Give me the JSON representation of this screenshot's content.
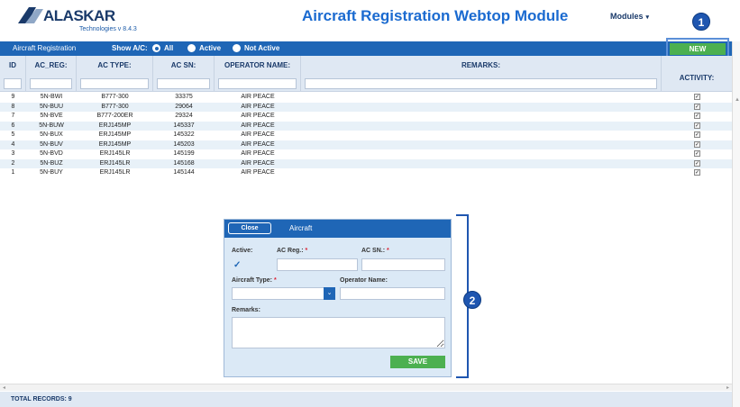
{
  "header": {
    "logo_text": "ALASKAR",
    "logo_sub": "Technologies v 8.4.3",
    "title": "Aircraft Registration Webtop Module",
    "modules_label": "Modules",
    "callout_1": "1",
    "callout_2": "2"
  },
  "toolbar": {
    "label": "Aircraft Registration",
    "show_label": "Show A/C:",
    "radio_all": "All",
    "radio_active": "Active",
    "radio_not_active": "Not Active",
    "selected": "All",
    "new_button": "NEW"
  },
  "grid": {
    "columns": [
      "ID",
      "AC_REG:",
      "AC TYPE:",
      "AC SN:",
      "OPERATOR NAME:",
      "REMARKS:",
      "ACTIVITY:"
    ],
    "rows": [
      {
        "id": "9",
        "reg": "5N-BWI",
        "type": "B777-300",
        "sn": "33375",
        "operator": "AIR PEACE",
        "remarks": "",
        "active": true
      },
      {
        "id": "8",
        "reg": "5N-BUU",
        "type": "B777-300",
        "sn": "29064",
        "operator": "AIR PEACE",
        "remarks": "",
        "active": true
      },
      {
        "id": "7",
        "reg": "5N-BVE",
        "type": "B777-200ER",
        "sn": "29324",
        "operator": "AIR PEACE",
        "remarks": "",
        "active": true
      },
      {
        "id": "6",
        "reg": "5N-BUW",
        "type": "ERJ145MP",
        "sn": "145337",
        "operator": "AIR PEACE",
        "remarks": "",
        "active": true
      },
      {
        "id": "5",
        "reg": "5N-BUX",
        "type": "ERJ145MP",
        "sn": "145322",
        "operator": "AIR PEACE",
        "remarks": "",
        "active": true
      },
      {
        "id": "4",
        "reg": "5N-BUV",
        "type": "ERJ145MP",
        "sn": "145203",
        "operator": "AIR PEACE",
        "remarks": "",
        "active": true
      },
      {
        "id": "3",
        "reg": "5N-BVD",
        "type": "ERJ145LR",
        "sn": "145199",
        "operator": "AIR PEACE",
        "remarks": "",
        "active": true
      },
      {
        "id": "2",
        "reg": "5N-BUZ",
        "type": "ERJ145LR",
        "sn": "145168",
        "operator": "AIR PEACE",
        "remarks": "",
        "active": true
      },
      {
        "id": "1",
        "reg": "5N-BUY",
        "type": "ERJ145LR",
        "sn": "145144",
        "operator": "AIR PEACE",
        "remarks": "",
        "active": true
      }
    ]
  },
  "dialog": {
    "close_button": "Close",
    "title": "Aircraft",
    "active_label": "Active:",
    "active_checked": true,
    "ac_reg_label": "AC Reg.:",
    "ac_sn_label": "AC SN.:",
    "required_mark": "*",
    "aircraft_type_label": "Aircraft Type:",
    "operator_name_label": "Operator Name:",
    "remarks_label": "Remarks:",
    "save_button": "SAVE",
    "ac_reg_value": "",
    "ac_sn_value": "",
    "aircraft_type_value": "",
    "operator_name_value": "",
    "remarks_value": ""
  },
  "footer": {
    "total_records": "TOTAL RECORDS: 9"
  },
  "colors": {
    "primary": "#1f66b6",
    "accent_green": "#4cb050",
    "title_blue": "#1a6ad0",
    "callout": "#1f56b0"
  },
  "icons": {
    "logo": "alaskar-wing-logo",
    "modules_caret": "chevron-down-icon",
    "select_arrow": "chevron-down-icon",
    "active_check": "check-icon"
  }
}
